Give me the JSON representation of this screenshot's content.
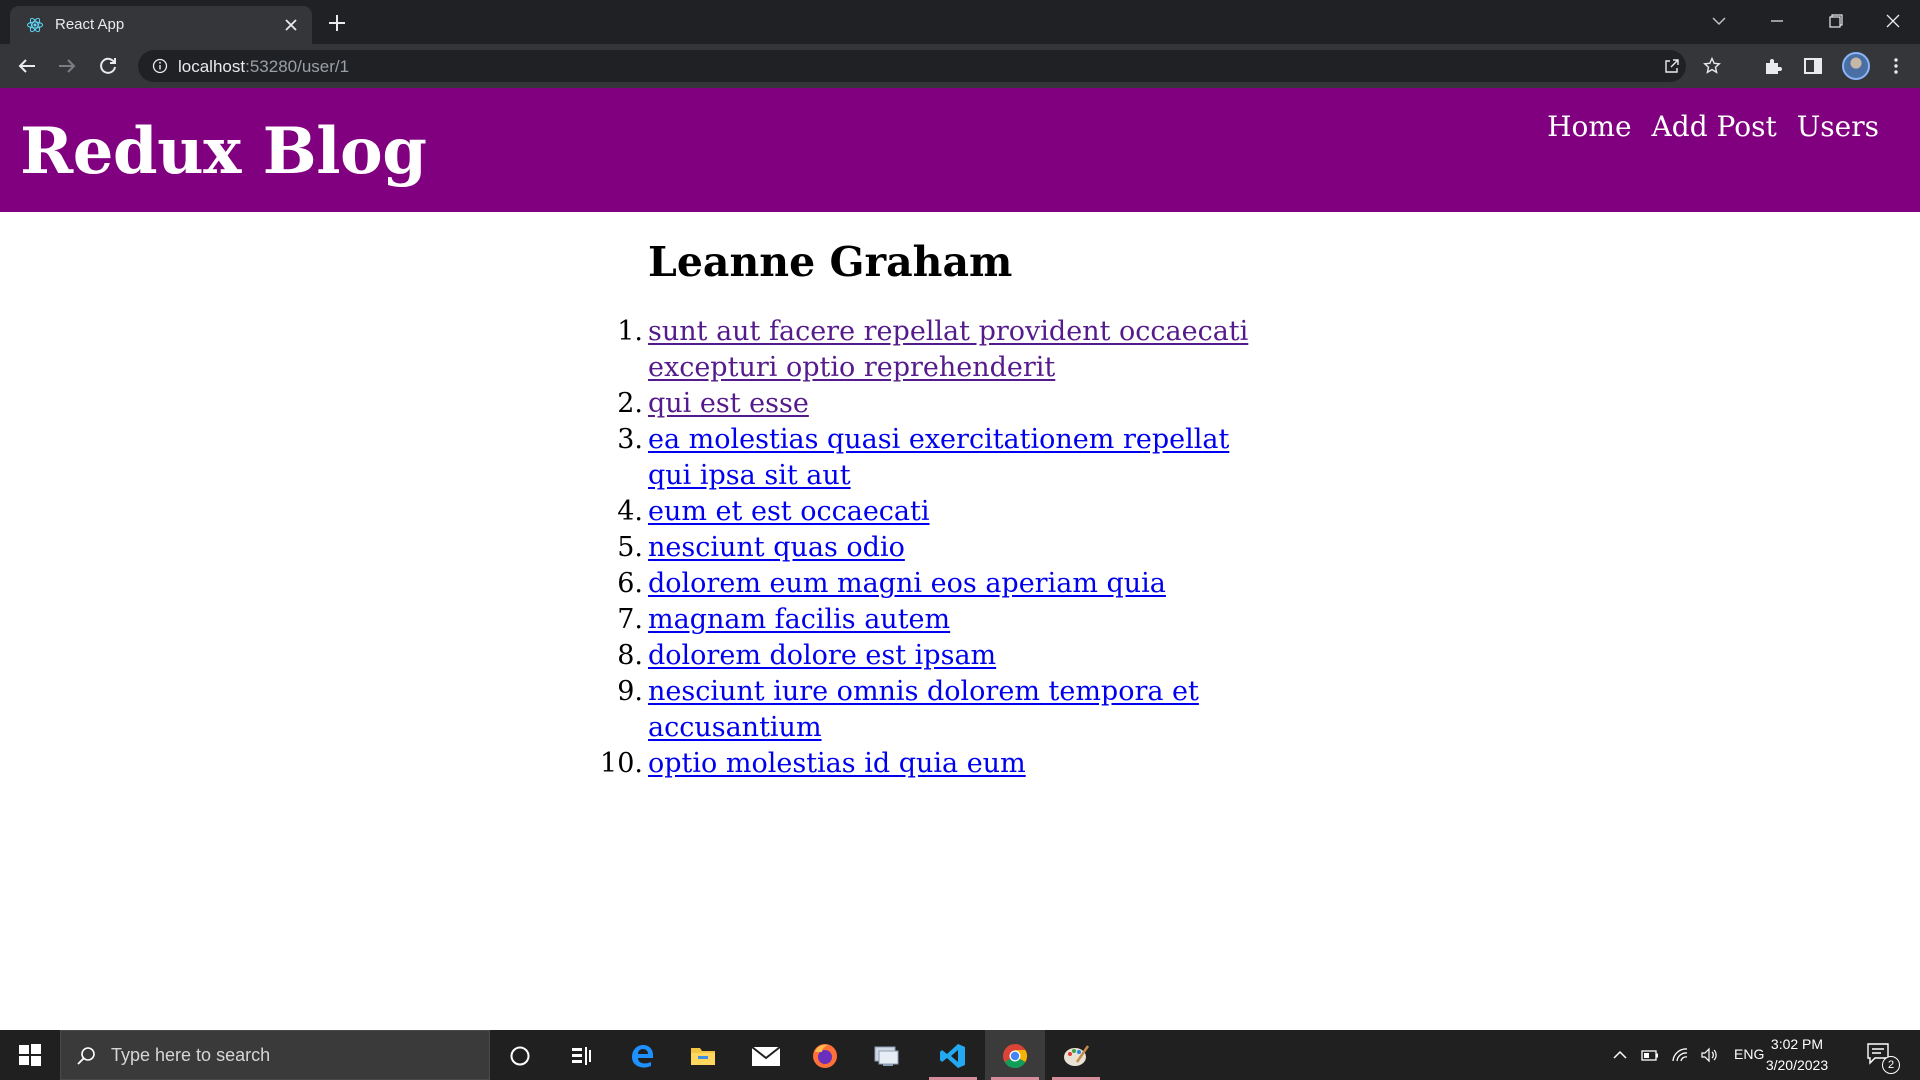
{
  "browser": {
    "tab_title": "React App",
    "url_host": "localhost",
    "url_rest": ":53280/user/1"
  },
  "app": {
    "brand": "Redux Blog",
    "nav": [
      "Home",
      "Add Post",
      "Users"
    ]
  },
  "user": {
    "name": "Leanne Graham",
    "posts": [
      {
        "num": "1.",
        "title": "sunt aut facere repellat provident occaecati excepturi optio reprehenderit",
        "visited": true
      },
      {
        "num": "2.",
        "title": "qui est esse",
        "visited": true
      },
      {
        "num": "3.",
        "title": "ea molestias quasi exercitationem repellat qui ipsa sit aut",
        "visited": false
      },
      {
        "num": "4.",
        "title": "eum et est occaecati",
        "visited": false
      },
      {
        "num": "5.",
        "title": "nesciunt quas odio",
        "visited": false
      },
      {
        "num": "6.",
        "title": "dolorem eum magni eos aperiam quia",
        "visited": false
      },
      {
        "num": "7.",
        "title": "magnam facilis autem",
        "visited": false
      },
      {
        "num": "8.",
        "title": "dolorem dolore est ipsam",
        "visited": false
      },
      {
        "num": "9.",
        "title": "nesciunt iure omnis dolorem tempora et accusantium",
        "visited": false
      },
      {
        "num": "10.",
        "title": "optio molestias id quia eum",
        "visited": false
      }
    ]
  },
  "colors": {
    "header_bg": "#800080",
    "link": "#0000ee",
    "visited_link": "#551a8b"
  },
  "taskbar": {
    "search_placeholder": "Type here to search",
    "language": "ENG",
    "time": "3:02 PM",
    "date": "3/20/2023",
    "notification_count": "2"
  }
}
